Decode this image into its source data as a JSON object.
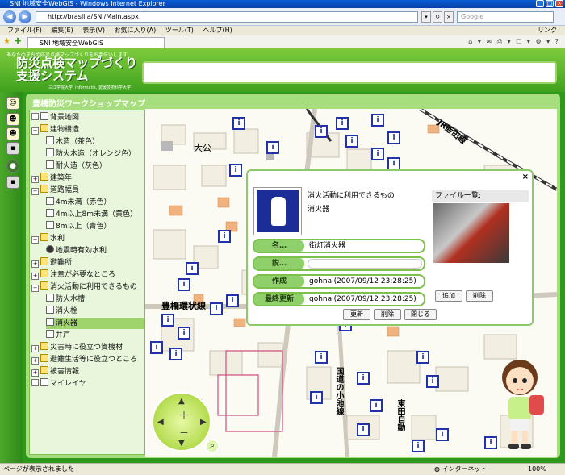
{
  "browser": {
    "window_title": "SNI 地域安全WebGIS - Windows Internet Explorer",
    "url": "http://brasilia/SNI/Main.aspx",
    "search_placeholder": "Google",
    "menu": [
      "ファイル(F)",
      "編集(E)",
      "表示(V)",
      "お気に入り(A)",
      "ツール(T)",
      "ヘルプ(H)"
    ],
    "links_label": "リンク",
    "tab_label": "SNI 地域安全WebGIS",
    "status_text": "ページが表示されました",
    "zone_text": "インターネット",
    "zoom_text": "100%"
  },
  "header": {
    "tagline": "あなたのまちの防災点検マップづくりをお手伝いします",
    "title_line1": "防災点検マップづくり",
    "title_line2": "支援システム",
    "credit": "三江学院大学, informatix, 愛媛技術科学大学"
  },
  "panel": {
    "title": "豊橋防災ワークショップマップ"
  },
  "tree": {
    "items": [
      {
        "label": "背景地図",
        "indent": 0,
        "icon": "doc",
        "expand": ""
      },
      {
        "label": "建物構造",
        "indent": 0,
        "icon": "folder",
        "expand": "-"
      },
      {
        "label": "木造（茶色）",
        "indent": 1,
        "icon": "doc",
        "expand": ""
      },
      {
        "label": "防火木造（オレンジ色）",
        "indent": 1,
        "icon": "doc",
        "expand": ""
      },
      {
        "label": "耐火造（灰色）",
        "indent": 1,
        "icon": "doc",
        "expand": ""
      },
      {
        "label": "建築年",
        "indent": 0,
        "icon": "folder",
        "expand": "+"
      },
      {
        "label": "道路幅員",
        "indent": 0,
        "icon": "folder",
        "expand": "-"
      },
      {
        "label": "4m未満（赤色）",
        "indent": 1,
        "icon": "doc",
        "expand": ""
      },
      {
        "label": "4m以上8m未満（黄色）",
        "indent": 1,
        "icon": "doc",
        "expand": ""
      },
      {
        "label": "8m以上（青色）",
        "indent": 1,
        "icon": "doc",
        "expand": ""
      },
      {
        "label": "水利",
        "indent": 0,
        "icon": "folder",
        "expand": "-"
      },
      {
        "label": "地震時有効水利",
        "indent": 1,
        "icon": "dot",
        "expand": ""
      },
      {
        "label": "避難所",
        "indent": 0,
        "icon": "folder",
        "expand": "+"
      },
      {
        "label": "注意が必要なところ",
        "indent": 0,
        "icon": "folder",
        "expand": "+"
      },
      {
        "label": "消火活動に利用できるもの",
        "indent": 0,
        "icon": "folder",
        "expand": "-"
      },
      {
        "label": "防火水槽",
        "indent": 1,
        "icon": "doc",
        "expand": ""
      },
      {
        "label": "消火栓",
        "indent": 1,
        "icon": "doc",
        "expand": ""
      },
      {
        "label": "消火器",
        "indent": 1,
        "icon": "doc",
        "expand": "",
        "selected": true
      },
      {
        "label": "井戸",
        "indent": 1,
        "icon": "doc",
        "expand": ""
      },
      {
        "label": "災害時に役立つ資機材",
        "indent": 0,
        "icon": "folder",
        "expand": "+"
      },
      {
        "label": "避難生活等に役立つところ",
        "indent": 0,
        "icon": "folder",
        "expand": "+"
      },
      {
        "label": "被害情報",
        "indent": 0,
        "icon": "folder",
        "expand": "+"
      },
      {
        "label": "マイレイヤ",
        "indent": 0,
        "icon": "doc",
        "expand": ""
      }
    ]
  },
  "map": {
    "labels": {
      "place1": "大公",
      "street1": "豊橋環状線",
      "rail": "JR飯田線",
      "road2": "国道の小池線",
      "road3": "東田自動"
    }
  },
  "popup": {
    "category": "消火活動に利用できるもの",
    "name": "消火器",
    "files_header": "ファイル一覧:",
    "rows": {
      "name_label": "名…",
      "name_value": "街灯消火器",
      "desc_label": "説…",
      "desc_value": "",
      "created_label": "作成",
      "created_value": "gohnai(2007/09/12 23:28:25)",
      "updated_label": "最終更新",
      "updated_value": "gohnai(2007/09/12 23:28:25)"
    },
    "buttons": {
      "add": "追加",
      "delete_file": "削除",
      "update": "更新",
      "delete": "削除",
      "close": "閉じる"
    }
  }
}
